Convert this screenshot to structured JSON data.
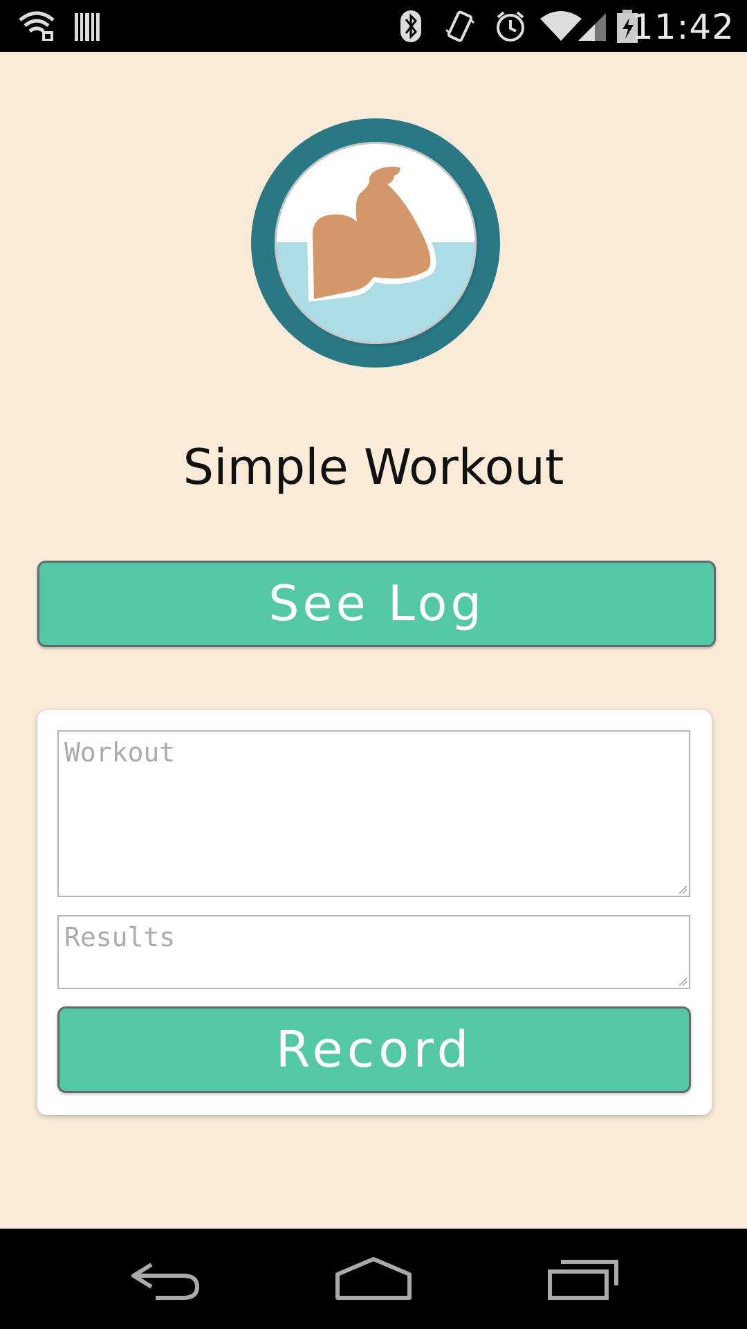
{
  "status_bar": {
    "time": "11:42",
    "icons": [
      "wifi-lock-icon",
      "barcode-icon",
      "bluetooth-icon",
      "vibrate-icon",
      "alarm-icon",
      "wifi-signal-icon",
      "cell-signal-icon",
      "battery-charging-icon"
    ]
  },
  "app": {
    "logo_icon": "flexed-bicep-icon",
    "title": "Simple Workout",
    "see_log_label": "See Log"
  },
  "form": {
    "workout_placeholder": "Workout",
    "workout_value": "",
    "results_placeholder": "Results",
    "results_value": "",
    "record_label": "Record"
  },
  "nav_bar": {
    "icons": [
      "back-icon",
      "home-icon",
      "recent-apps-icon"
    ]
  },
  "colors": {
    "background": "#f9ebd8",
    "button": "#54c8a6",
    "logo_ring": "#2a7886",
    "logo_water": "#acdde7",
    "arm": "#d4976a"
  }
}
